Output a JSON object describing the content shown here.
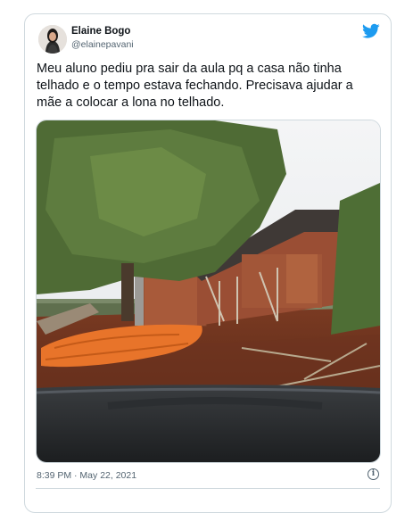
{
  "tweet": {
    "author_name": "Elaine Bogo",
    "author_handle": "@elainepavani",
    "text": "Meu aluno pediu pra sair da aula pq a casa não tinha telhado e o tempo estava fechando. Precisava ajudar a mãe a colocar a lona no telhado.",
    "timestamp": "8:39 PM · May 22, 2021",
    "info_glyph": "i"
  },
  "icons": {
    "brand": "twitter-bird-icon",
    "info": "info-icon"
  },
  "colors": {
    "brand_blue": "#1d9bf0",
    "border": "#cfd9de",
    "muted_text": "#536471",
    "primary_text": "#0f1419",
    "tarp_orange": "#e8742a",
    "red_soil": "#8a3a20"
  }
}
